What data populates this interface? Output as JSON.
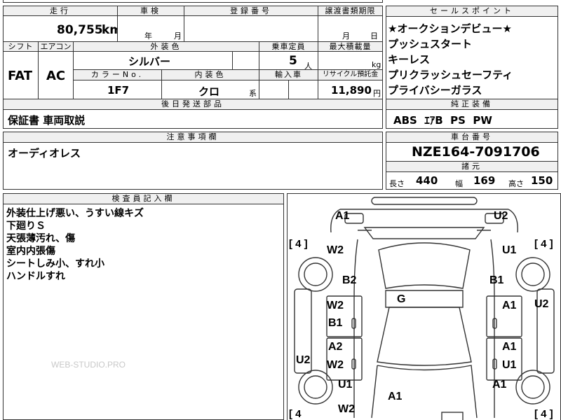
{
  "vehicle": {
    "mileage_label": "走行",
    "mileage_value": "80,755",
    "mileage_unit": "km",
    "inspection_label": "車検",
    "inspection_year_unit": "年",
    "inspection_month_unit": "月",
    "registration_label": "登録番号",
    "transfer_label": "譲渡書類期限",
    "transfer_month_unit": "月",
    "transfer_day_unit": "日",
    "shift_label": "シフト",
    "shift_value": "FAT",
    "aircon_label": "エアコン",
    "aircon_value": "AC",
    "exterior_color_label": "外装色",
    "exterior_color_value": "シルバー",
    "capacity_label": "乗車定員",
    "capacity_value": "5",
    "capacity_unit": "人",
    "max_load_label": "最大積載量",
    "max_load_unit": "kg",
    "color_no_label": "カラーNo.",
    "color_no_value": "1F7",
    "interior_color_label": "内装色",
    "interior_color_value": "クロ",
    "interior_color_suffix": "系",
    "import_label": "輸入車",
    "recycle_label": "リサイクル預託金",
    "recycle_value": "11,890",
    "recycle_unit": "円",
    "later_parts_label": "後日発送部品",
    "later_parts_value": "保証書 車両取説",
    "notes_label": "注意事項欄",
    "notes_value": "オーディオレス"
  },
  "sales_points": {
    "label": "セールスポイント",
    "items": [
      "★オークションデビュー★",
      "プッシュスタート",
      "キーレス",
      "プリクラッシュセーフティ",
      "プライバシーガラス"
    ]
  },
  "equipment": {
    "label": "純正装備",
    "value": "ABS  ｴｱB  PS  PW"
  },
  "chassis": {
    "label": "車台番号",
    "value": "NZE164-7091706"
  },
  "specs": {
    "label": "諸元",
    "length_label": "長さ",
    "length_value": "440",
    "width_label": "幅",
    "width_value": "169",
    "height_label": "高さ",
    "height_value": "150"
  },
  "inspector": {
    "label": "検査員記入欄",
    "lines": [
      "外装仕上げ悪い、うすい線キズ",
      "下廻りＳ",
      "天張薄汚れ、傷",
      "室内内張傷",
      "シートしみ小、すれ小",
      "ハンドルすれ"
    ]
  },
  "watermark": "WEB-STUDIO.PRO",
  "diagram": {
    "front_left_tire": "[ 4 ]",
    "front_right_tire": "[ 4 ]",
    "rear_left_tire": "[ 4",
    "rear_right_tire": "[ 4 ]",
    "marks": {
      "front_left_corner": "A1",
      "front_right_corner": "U2",
      "left_fender": "W2",
      "right_fender": "U1",
      "left_pillar": "B2",
      "right_pillar": "B1",
      "roof": "G",
      "left_front_door_1": "W2",
      "left_front_door_2": "B1",
      "right_front_door": "A1",
      "right_side": "U2",
      "left_rear_door_1": "A2",
      "left_rear_door_2": "W2",
      "right_rear_door_1": "A1",
      "right_rear_door_2": "U1",
      "left_side": "U2",
      "left_quarter": "U1",
      "right_quarter": "A1",
      "trunk": "A1",
      "rear_left": "W2"
    }
  }
}
